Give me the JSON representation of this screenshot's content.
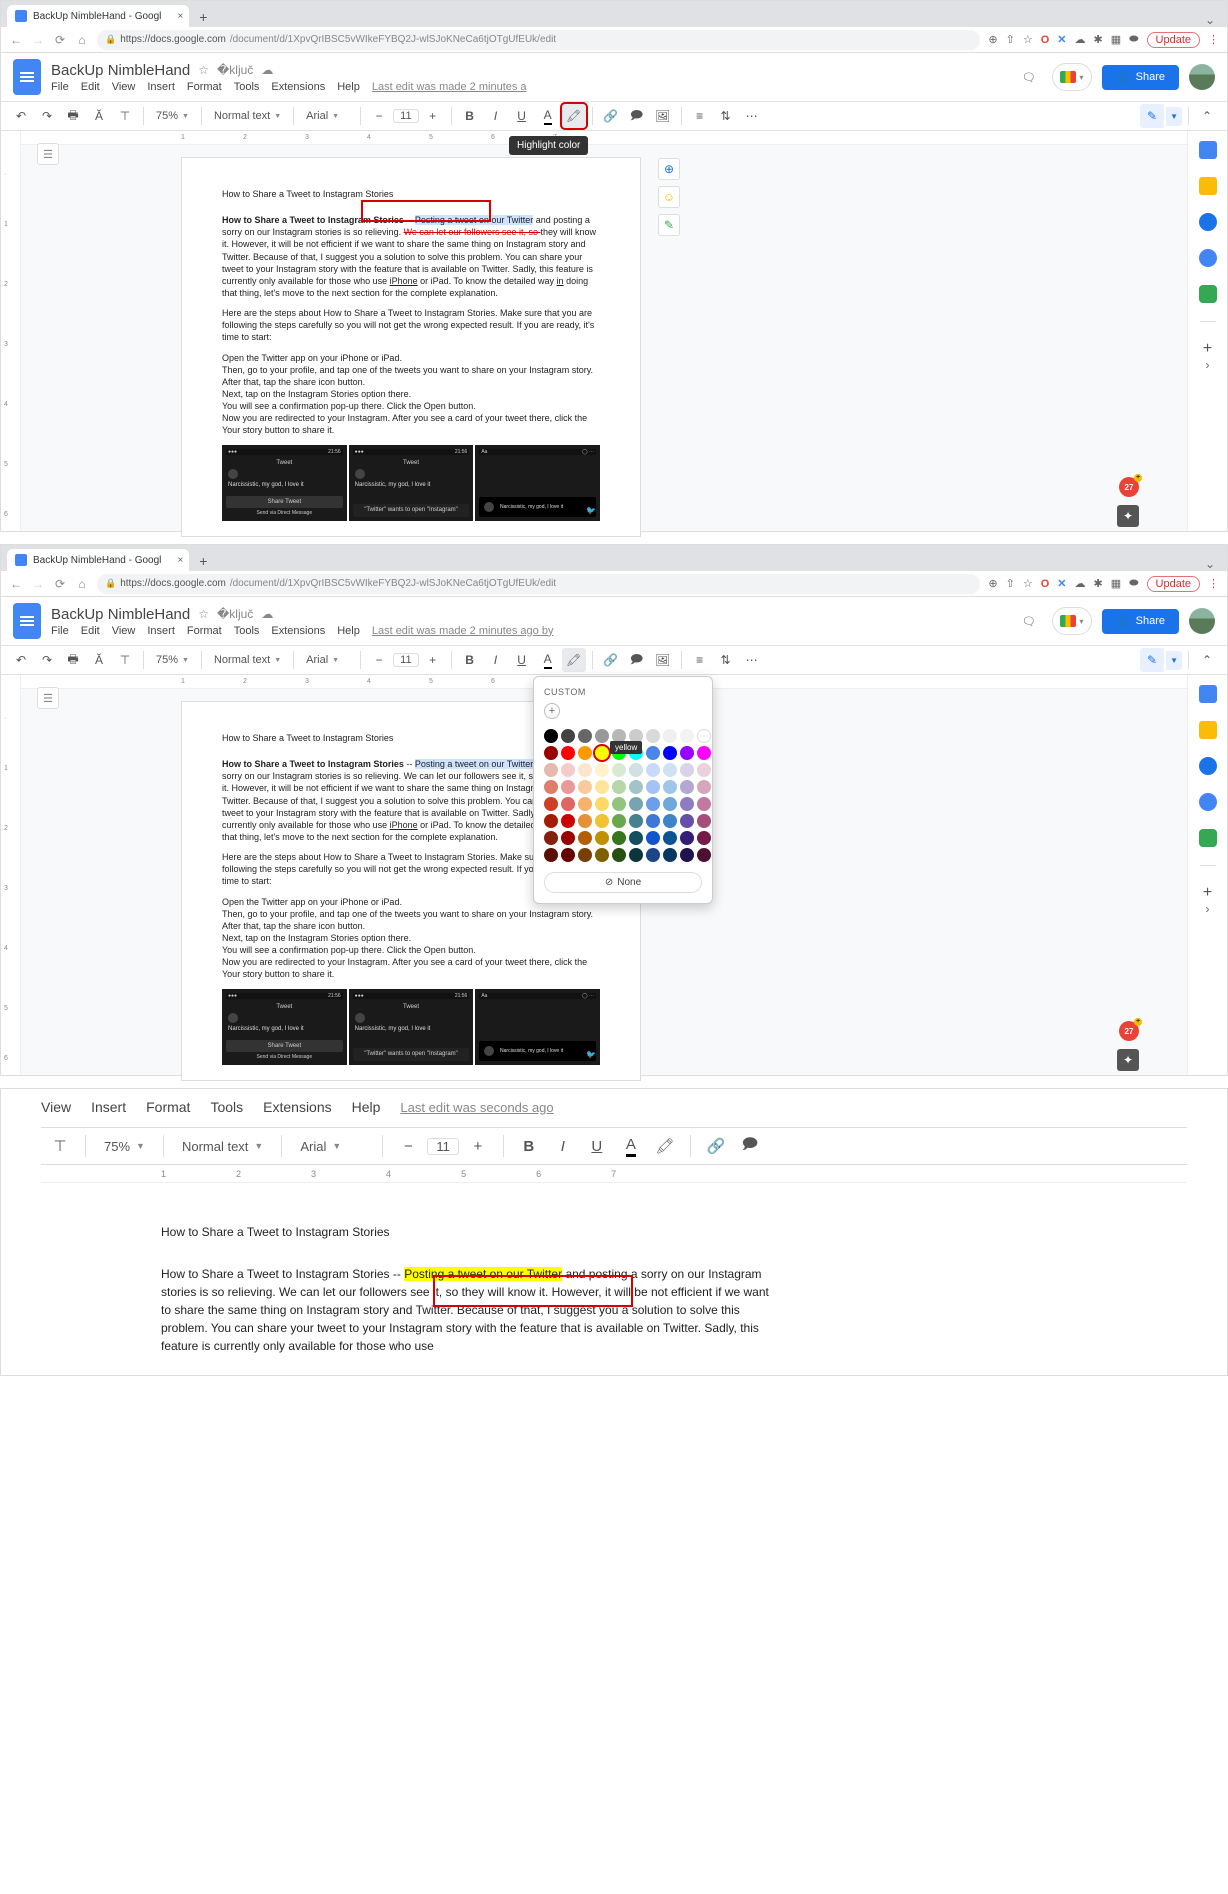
{
  "browser": {
    "tab_title": "BackUp NimbleHand - Googl",
    "url_host": "https://docs.google.com",
    "url_path": "/document/d/1XpvQrIBSC5vWIkeFYBQ2J-wlSJoKNeCa6tjOTgUfEUk/edit",
    "update_label": "Update"
  },
  "docs": {
    "title": "BackUp NimbleHand",
    "menus": [
      "File",
      "Edit",
      "View",
      "Insert",
      "Format",
      "Tools",
      "Extensions",
      "Help"
    ],
    "last_edit_1": "Last edit was made 2 minutes a",
    "last_edit_2": "Last edit was made 2 minutes ago by",
    "last_edit_3": "Last edit was seconds ago",
    "share": "Share",
    "zoom": "75%",
    "style": "Normal text",
    "font": "Arial",
    "font_size": "11",
    "tooltip_highlight": "Highlight color",
    "color_popover": {
      "custom_label": "CUSTOM",
      "yellow_tooltip": "yellow",
      "none_label": "None"
    }
  },
  "content": {
    "h1": "How to Share a Tweet to Instagram Stories",
    "para1_bold": "How to Share a Tweet to Instagram Stories",
    "para1_sep": " -- ",
    "para1_selected": "Posting a tweet on our Twitter",
    "para1_tail_a": " and posting a sorry on our Instagram stories is so relieving. ",
    "para1_strike": "We can let our followers see it, so ",
    "para1_plain_alt": "We can let our followers see it, so ",
    "para1_tail_b": "they will know it. However, it will be not efficient if we want to share the same thing on Instagram story and Twitter. Because of that, I suggest you a solution to solve this problem. You can share your tweet to your Instagram story with the feature that is available on Twitter. Sadly, this feature is currently only available for those who use ",
    "para1_iphone": "iPhone",
    "para1_tail_c": " or iPad. To know the detailed way ",
    "para1_in": "in",
    "para1_tail_d": " doing that thing, let's move to the next section for the complete explanation.",
    "para2": "Here are the steps about How to Share a Tweet to Instagram Stories. Make sure that you are following the steps carefully so you will not get the wrong expected result. If you are ready, it's time to start:",
    "steps": [
      "Open the Twitter app on your iPhone or iPad.",
      "Then, go to your profile, and tap one of the tweets you want to share on your Instagram story.",
      "After that, tap the share icon button.",
      "Next, tap on the Instagram Stories option there.",
      "You will see a confirmation pop-up there. Click the Open button.",
      "Now you are redirected to your Instagram. After you see a card of your tweet there, click the Your story button to share it."
    ],
    "img_labels": {
      "time": "21:56",
      "tweet_head": "Tweet",
      "tweet_text": "Narcissistic, my god, I love it",
      "share_tweet": "Share Tweet",
      "send_dm": "Send via Direct Message",
      "wants_open": "\"Twitter\" wants to open \"Instagram\""
    }
  },
  "color_grid": [
    [
      "#000000",
      "#434343",
      "#666666",
      "#999999",
      "#b7b7b7",
      "#cccccc",
      "#d9d9d9",
      "#efefef",
      "#f3f3f3",
      "#ffffff"
    ],
    [
      "#980000",
      "#ff0000",
      "#ff9900",
      "#ffff00",
      "#00ff00",
      "#00ffff",
      "#4a86e8",
      "#0000ff",
      "#9900ff",
      "#ff00ff"
    ],
    [
      "#e6b8af",
      "#f4cccc",
      "#fce5cd",
      "#fff2cc",
      "#d9ead3",
      "#d0e0e3",
      "#c9daf8",
      "#cfe2f3",
      "#d9d2e9",
      "#ead1dc"
    ],
    [
      "#dd7e6b",
      "#ea9999",
      "#f9cb9c",
      "#ffe599",
      "#b6d7a8",
      "#a2c4c9",
      "#a4c2f4",
      "#9fc5e8",
      "#b4a7d6",
      "#d5a6bd"
    ],
    [
      "#cc4125",
      "#e06666",
      "#f6b26b",
      "#ffd966",
      "#93c47d",
      "#76a5af",
      "#6d9eeb",
      "#6fa8dc",
      "#8e7cc3",
      "#c27ba0"
    ],
    [
      "#a61c00",
      "#cc0000",
      "#e69138",
      "#f1c232",
      "#6aa84f",
      "#45818e",
      "#3c78d8",
      "#3d85c6",
      "#674ea7",
      "#a64d79"
    ],
    [
      "#85200c",
      "#990000",
      "#b45f06",
      "#bf9000",
      "#38761d",
      "#134f5c",
      "#1155cc",
      "#0b5394",
      "#351c75",
      "#741b47"
    ],
    [
      "#5b0f00",
      "#660000",
      "#783f04",
      "#7f6000",
      "#274e13",
      "#0c343d",
      "#1c4587",
      "#073763",
      "#20124d",
      "#4c1130"
    ]
  ]
}
